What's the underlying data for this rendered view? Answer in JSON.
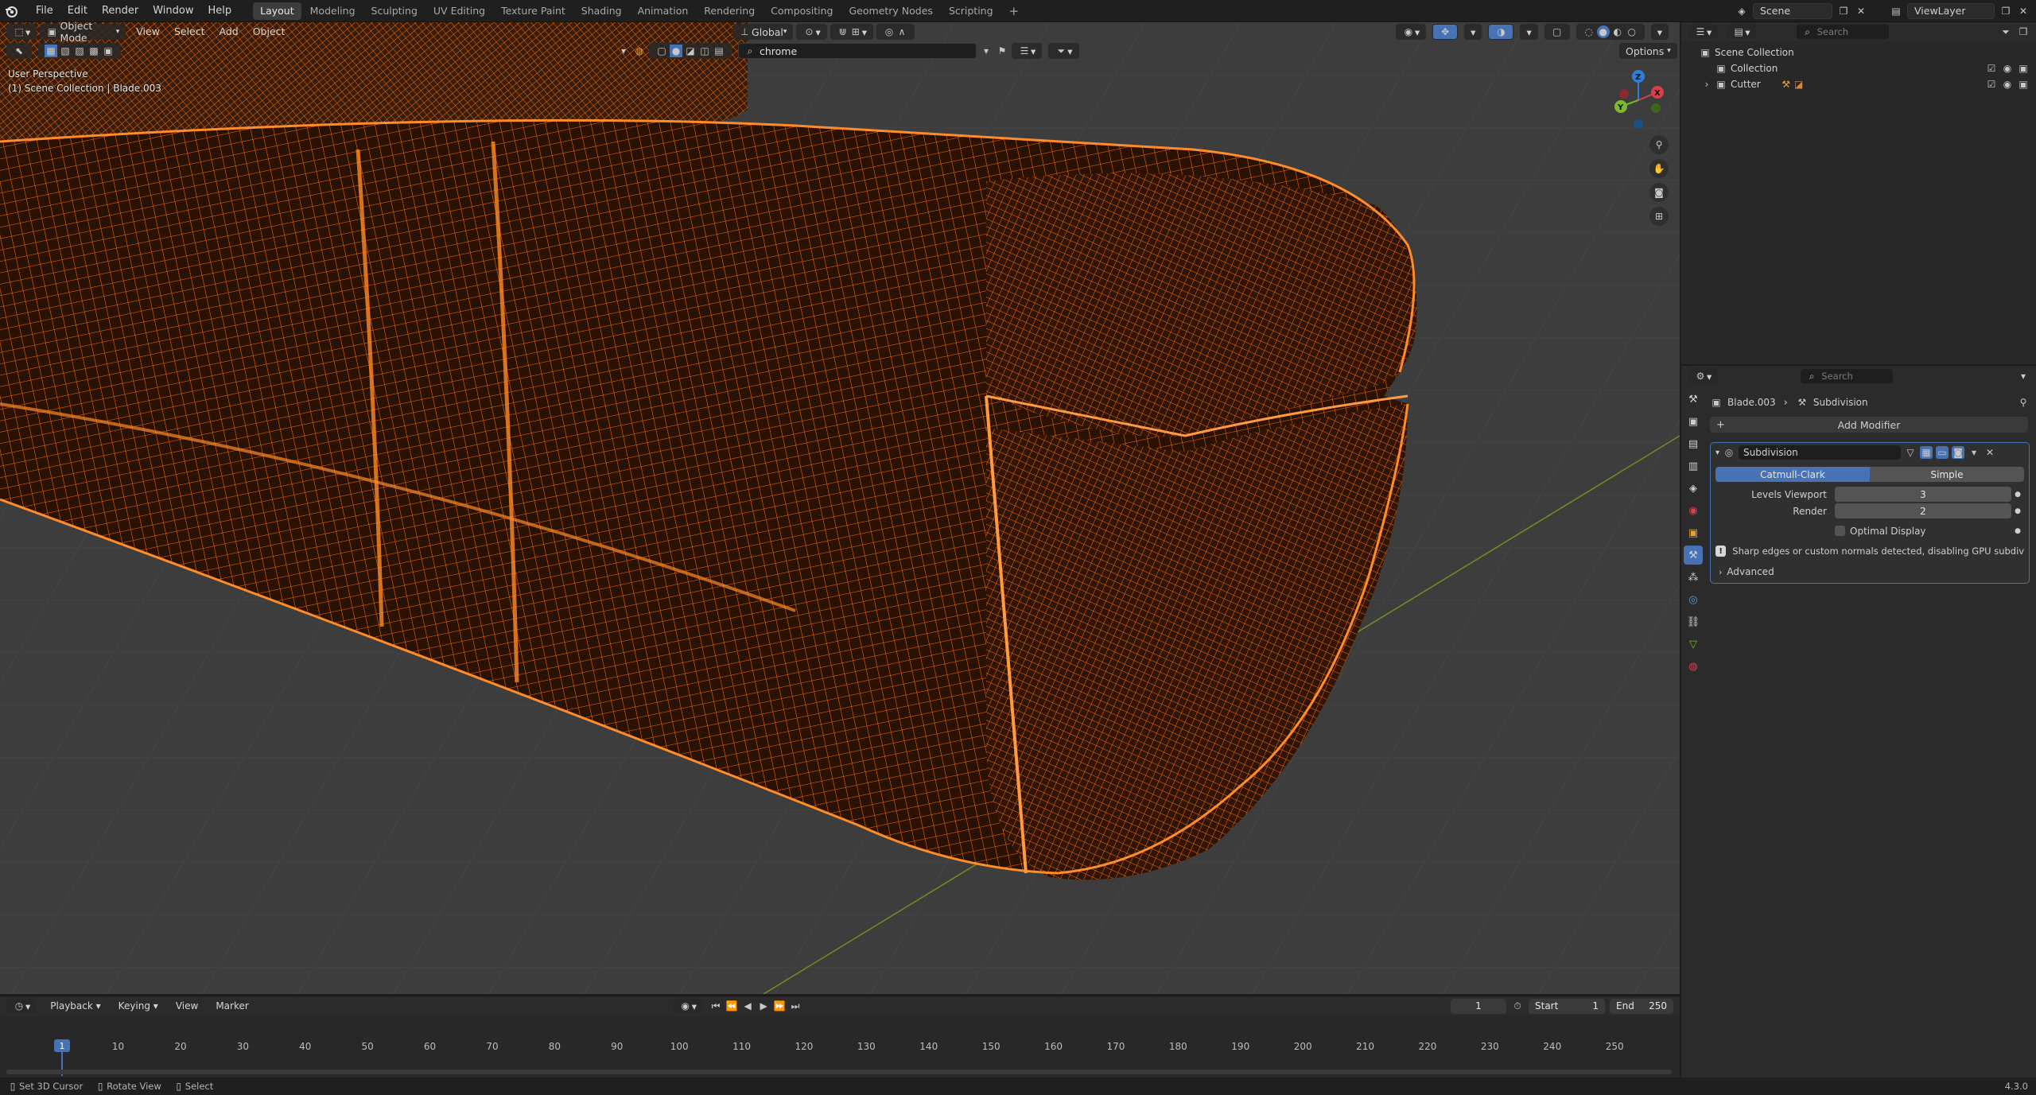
{
  "menu": {
    "items": [
      "File",
      "Edit",
      "Render",
      "Window",
      "Help"
    ]
  },
  "workspaces": {
    "tabs": [
      "Layout",
      "Modeling",
      "Sculpting",
      "UV Editing",
      "Texture Paint",
      "Shading",
      "Animation",
      "Rendering",
      "Compositing",
      "Geometry Nodes",
      "Scripting"
    ],
    "active": "Layout"
  },
  "scene": {
    "name": "Scene",
    "view_layer": "ViewLayer"
  },
  "viewport_header": {
    "mode": "Object Mode",
    "menus": [
      "View",
      "Select",
      "Add",
      "Object"
    ],
    "orientation": "Global",
    "options_label": "Options",
    "search_value": "chrome"
  },
  "viewport_overlay": {
    "perspective": "User Perspective",
    "collection_info": "(1) Scene Collection | Blade.003"
  },
  "gizmo": {
    "x": "X",
    "y": "Y",
    "z": "Z"
  },
  "outliner": {
    "search_placeholder": "Search",
    "root": "Scene Collection",
    "items": [
      {
        "label": "Collection"
      },
      {
        "label": "Cutter"
      }
    ]
  },
  "properties": {
    "search_placeholder": "Search",
    "breadcrumb_object": "Blade.003",
    "breadcrumb_modifier": "Subdivision",
    "add_modifier": "Add Modifier",
    "modifier_name": "Subdivision",
    "algo_options": [
      "Catmull-Clark",
      "Simple"
    ],
    "algo_selected": "Catmull-Clark",
    "levels_viewport_label": "Levels Viewport",
    "levels_viewport": "3",
    "render_label": "Render",
    "render_value": "2",
    "optimal_display": "Optimal Display",
    "warning": "Sharp edges or custom normals detected, disabling GPU subdivis...",
    "advanced": "Advanced"
  },
  "timeline": {
    "menus": [
      "Playback",
      "Keying",
      "View",
      "Marker"
    ],
    "current_frame": "1",
    "start_label": "Start",
    "start": "1",
    "end_label": "End",
    "end": "250",
    "ticks": [
      "10",
      "20",
      "30",
      "40",
      "50",
      "60",
      "70",
      "80",
      "90",
      "100",
      "110",
      "120",
      "130",
      "140",
      "150",
      "160",
      "170",
      "180",
      "190",
      "200",
      "210",
      "220",
      "230",
      "240",
      "250"
    ],
    "playhead": "1"
  },
  "statusbar": {
    "hint1": "Set 3D Cursor",
    "hint2": "Rotate View",
    "hint3": "Select",
    "version": "4.3.0"
  },
  "colors": {
    "accent": "#4772b3",
    "wire": "#ff6a00",
    "grid_x": "#8b3a3a",
    "grid_y": "#6b8e23"
  }
}
